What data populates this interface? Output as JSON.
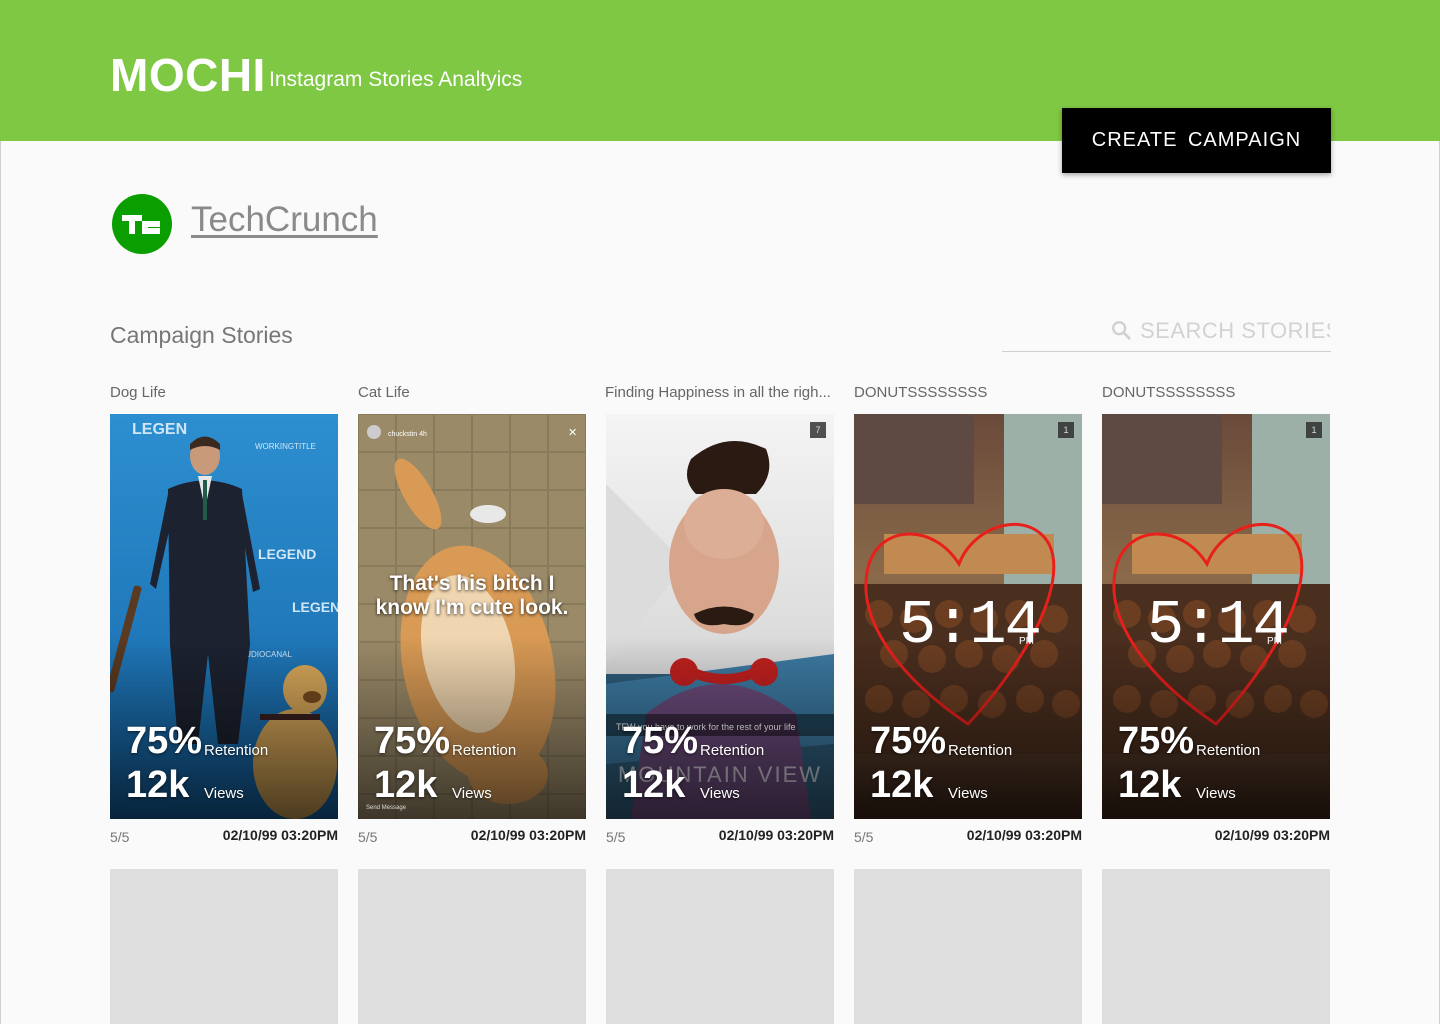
{
  "header": {
    "brand": "MOCHI",
    "subtitle": "Instagram Stories Analtyics",
    "create_button": "CREATE  CAMPAIGN"
  },
  "account": {
    "name": "TechCrunch",
    "logo_text": "TC"
  },
  "section": {
    "title": "Campaign Stories"
  },
  "search": {
    "placeholder": "SEARCH STORIES"
  },
  "cards": [
    {
      "title": "Dog Life",
      "retention": "75%",
      "retention_label": "Retention",
      "views": "12k",
      "views_label": "Views",
      "count": "5/5",
      "date": "02/10/99 03:20PM"
    },
    {
      "title": "Cat Life",
      "retention": "75%",
      "retention_label": "Retention",
      "views": "12k",
      "views_label": "Views",
      "count": "5/5",
      "date": "02/10/99 03:20PM",
      "overlay": "That's his bitch I know I'm cute look.",
      "user": "chuckstin",
      "user_time": "4h",
      "footer": "Send Message"
    },
    {
      "title": "Finding Happiness in all the righ...",
      "retention": "75%",
      "retention_label": "Retention",
      "views": "12k",
      "views_label": "Views",
      "count": "5/5",
      "date": "02/10/99 03:20PM",
      "badge": "7",
      "caption": "TFW you have to work for the rest of your life",
      "location": "MOUNTAIN VIEW"
    },
    {
      "title": "DONUTSSSSSSSS",
      "retention": "75%",
      "retention_label": "Retention",
      "views": "12k",
      "views_label": "Views",
      "count": "5/5",
      "date": "02/10/99 03:20PM",
      "badge": "1",
      "clock": "5:14",
      "clock_suffix": "PM"
    },
    {
      "title": "DONUTSSSSSSSS",
      "retention": "75%",
      "retention_label": "Retention",
      "views": "12k",
      "views_label": "Views",
      "count": "",
      "date": "02/10/99 03:20PM",
      "badge": "1",
      "clock": "5:14",
      "clock_suffix": "PM"
    }
  ],
  "colors": {
    "header": "#7ec843",
    "brand_green": "#0a9e01",
    "button": "#000000"
  },
  "icons": {
    "search": "search-icon"
  }
}
